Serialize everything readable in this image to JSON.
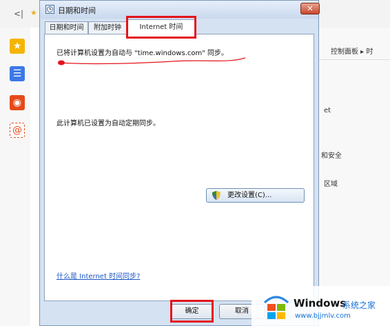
{
  "background": {
    "back_glyph": "<|",
    "breadcrumb": "控制面板 ▸ 时",
    "item_et": "et",
    "item_security": "和安全",
    "item_region": "区域"
  },
  "dialog": {
    "title": "日期和时间",
    "close_glyph": "✕",
    "tabs": [
      {
        "label": "日期和时间"
      },
      {
        "label": "附加时钟"
      },
      {
        "label": "Internet 时间"
      }
    ],
    "active_tab": "Internet 时间",
    "status_line": "已将计算机设置为自动与 \"time.windows.com\" 同步。",
    "schedule_line": "此计算机已设置为自动定期同步。",
    "change_settings_label": "更改设置(C)...",
    "help_link": "什么是 Internet 时间同步?",
    "ok_label": "确定",
    "cancel_label": "取消"
  },
  "watermark": {
    "brand": "Windows",
    "site_name": "系统之家",
    "url": "www.bjjmlv.com"
  },
  "colors": {
    "highlight": "#e4141b",
    "link": "#1a56c4",
    "title_bg": "#c9d9ee"
  }
}
